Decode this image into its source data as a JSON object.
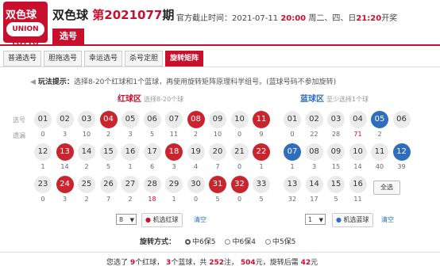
{
  "header": {
    "logo_line1": "双色球",
    "logo_line2": "UNION LOTTO",
    "title": "双色球",
    "issue_prefix": "第",
    "issue": "2021077",
    "issue_suffix": "期",
    "deadline_label": "官方截止时间：",
    "deadline_date": "2021-07-11",
    "deadline_time": "20:00",
    "draw_days": "周二、四、日",
    "draw_time": "21:20",
    "draw_suffix": "开奖",
    "main_tab": "选号"
  },
  "subtabs": [
    "普通选号",
    "胆拖选号",
    "幸运选号",
    "杀号定胆",
    "旋转矩阵"
  ],
  "tip": {
    "label": "玩法提示：",
    "text": "选择8-20个红球和1个蓝球，再使用旋转矩阵原理科学组号。(蓝球号码不参加旋转)"
  },
  "red_area": {
    "title": "红球区",
    "subtitle": "选择8-20个球",
    "row_label_1": "选号",
    "row_label_2": "遗漏",
    "balls": [
      {
        "n": "01",
        "m": "0",
        "s": false
      },
      {
        "n": "02",
        "m": "3",
        "s": false
      },
      {
        "n": "03",
        "m": "10",
        "s": false
      },
      {
        "n": "04",
        "m": "2",
        "s": true
      },
      {
        "n": "05",
        "m": "3",
        "s": false
      },
      {
        "n": "06",
        "m": "5",
        "s": false
      },
      {
        "n": "07",
        "m": "11",
        "s": false
      },
      {
        "n": "08",
        "m": "2",
        "s": true
      },
      {
        "n": "09",
        "m": "10",
        "s": false
      },
      {
        "n": "10",
        "m": "0",
        "s": false
      },
      {
        "n": "11",
        "m": "9",
        "s": true
      },
      {
        "n": "12",
        "m": "1",
        "s": false
      },
      {
        "n": "13",
        "m": "14",
        "s": true
      },
      {
        "n": "14",
        "m": "2",
        "s": false
      },
      {
        "n": "15",
        "m": "5",
        "s": false
      },
      {
        "n": "16",
        "m": "1",
        "s": false
      },
      {
        "n": "17",
        "m": "6",
        "s": false
      },
      {
        "n": "18",
        "m": "3",
        "s": true
      },
      {
        "n": "19",
        "m": "4",
        "s": false
      },
      {
        "n": "20",
        "m": "7",
        "s": false
      },
      {
        "n": "21",
        "m": "0",
        "s": false
      },
      {
        "n": "22",
        "m": "1",
        "s": true
      },
      {
        "n": "23",
        "m": "0",
        "s": false
      },
      {
        "n": "24",
        "m": "3",
        "s": true
      },
      {
        "n": "25",
        "m": "2",
        "s": false
      },
      {
        "n": "26",
        "m": "7",
        "s": false
      },
      {
        "n": "27",
        "m": "2",
        "s": false
      },
      {
        "n": "28",
        "m": "18",
        "s": false,
        "hot": true
      },
      {
        "n": "29",
        "m": "1",
        "s": false
      },
      {
        "n": "30",
        "m": "0",
        "s": false
      },
      {
        "n": "31",
        "m": "5",
        "s": true
      },
      {
        "n": "32",
        "m": "0",
        "s": true
      },
      {
        "n": "33",
        "m": "5",
        "s": false
      }
    ],
    "select_value": "8",
    "machine_label": "机选红球",
    "clear_label": "清空"
  },
  "blue_area": {
    "title": "蓝球区",
    "subtitle": "至少选择1个球",
    "balls": [
      {
        "n": "01",
        "m": "0",
        "s": false
      },
      {
        "n": "02",
        "m": "22",
        "s": false
      },
      {
        "n": "03",
        "m": "28",
        "s": false
      },
      {
        "n": "04",
        "m": "71",
        "s": false,
        "hot": true
      },
      {
        "n": "05",
        "m": "2",
        "s": true
      },
      {
        "n": "06",
        "m": "",
        "s": false
      },
      {
        "n": "07",
        "m": "1",
        "s": true
      },
      {
        "n": "08",
        "m": "3",
        "s": false
      },
      {
        "n": "09",
        "m": "15",
        "s": false
      },
      {
        "n": "10",
        "m": "14",
        "s": false
      },
      {
        "n": "11",
        "m": "40",
        "s": false
      },
      {
        "n": "12",
        "m": "39",
        "s": true
      },
      {
        "n": "13",
        "m": "32",
        "s": false
      },
      {
        "n": "14",
        "m": "17",
        "s": false
      },
      {
        "n": "15",
        "m": "5",
        "s": false
      },
      {
        "n": "16",
        "m": "11",
        "s": false
      }
    ],
    "all_label": "全选",
    "select_value": "1",
    "machine_label": "机选蓝球",
    "clear_label": "清空"
  },
  "rotation": {
    "label": "旋转方式：",
    "options": [
      "中6保5",
      "中6保4",
      "中5保5"
    ],
    "selected_index": 0
  },
  "summary": {
    "t1": "您选了",
    "red_count": "9",
    "t2": "个红球，",
    "blue_count": "3",
    "t3": "个蓝球，共",
    "bets": "252",
    "t4": "注，",
    "amount": "504",
    "t5": "元，旋转后需",
    "rot_amount": "42",
    "t6": "元"
  },
  "colors": {
    "accent": "#c8102e",
    "red_ball": "#c8252f",
    "blue_ball": "#2f6dbf",
    "blue_title": "#2f6dbf"
  }
}
